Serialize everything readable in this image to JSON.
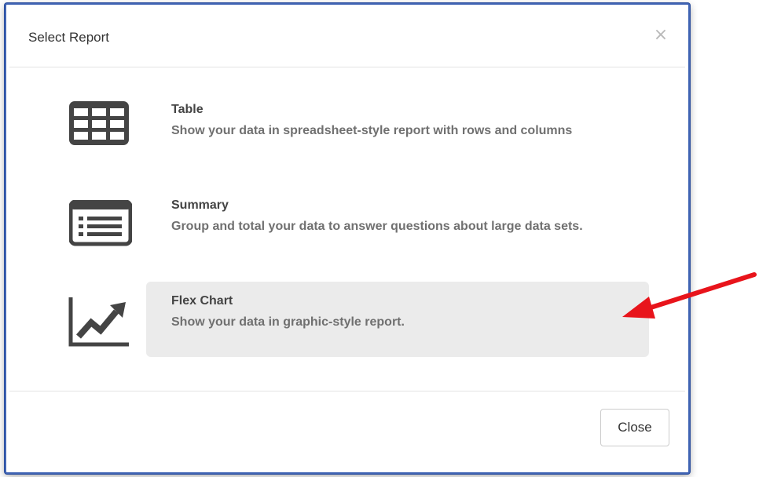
{
  "dialog": {
    "title": "Select Report",
    "close_glyph": "×",
    "close_button_label": "Close"
  },
  "options": [
    {
      "title": "Table",
      "description": "Show your data in spreadsheet-style report with rows and columns",
      "icon": "table-grid-icon",
      "selected": false
    },
    {
      "title": "Summary",
      "description": "Group and total your data to answer questions about large data sets.",
      "icon": "summary-list-icon",
      "selected": false
    },
    {
      "title": "Flex Chart",
      "description": "Show your data in graphic-style report.",
      "icon": "line-chart-icon",
      "selected": true
    }
  ],
  "annotation": {
    "arrow_icon": "red-arrow-icon",
    "arrow_color": "#e8141b"
  },
  "colors": {
    "modal_border": "#4064b4",
    "selected_row_bg": "#ebebeb",
    "icon_color": "#444444"
  }
}
